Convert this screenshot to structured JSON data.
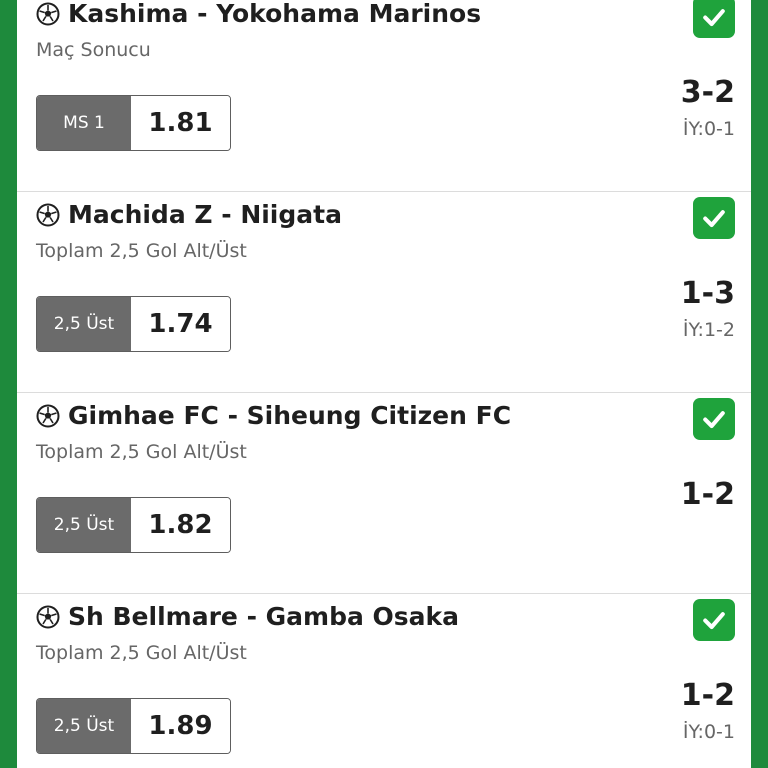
{
  "colors": {
    "frame": "#1e8a3c",
    "won": "#1fa33c",
    "selection": "#6b6b6b"
  },
  "status_icon": "check-icon",
  "sport_icon": "soccer-ball-icon",
  "bets": [
    {
      "match": "Kashima - Yokohama Marinos",
      "market": "Maç Sonucu",
      "selection": "MS 1",
      "odds": "1.81",
      "score": "3-2",
      "halftime": "İY:0-1",
      "status": "won"
    },
    {
      "match": "Machida Z - Niigata",
      "market": "Toplam 2,5 Gol Alt/Üst",
      "selection": "2,5 Üst",
      "odds": "1.74",
      "score": "1-3",
      "halftime": "İY:1-2",
      "status": "won"
    },
    {
      "match": "Gimhae FC - Siheung Citizen FC",
      "market": "Toplam 2,5 Gol Alt/Üst",
      "selection": "2,5 Üst",
      "odds": "1.82",
      "score": "1-2",
      "halftime": "",
      "status": "won"
    },
    {
      "match": "Sh Bellmare - Gamba Osaka",
      "market": "Toplam 2,5 Gol Alt/Üst",
      "selection": "2,5 Üst",
      "odds": "1.89",
      "score": "1-2",
      "halftime": "İY:0-1",
      "status": "won"
    }
  ]
}
